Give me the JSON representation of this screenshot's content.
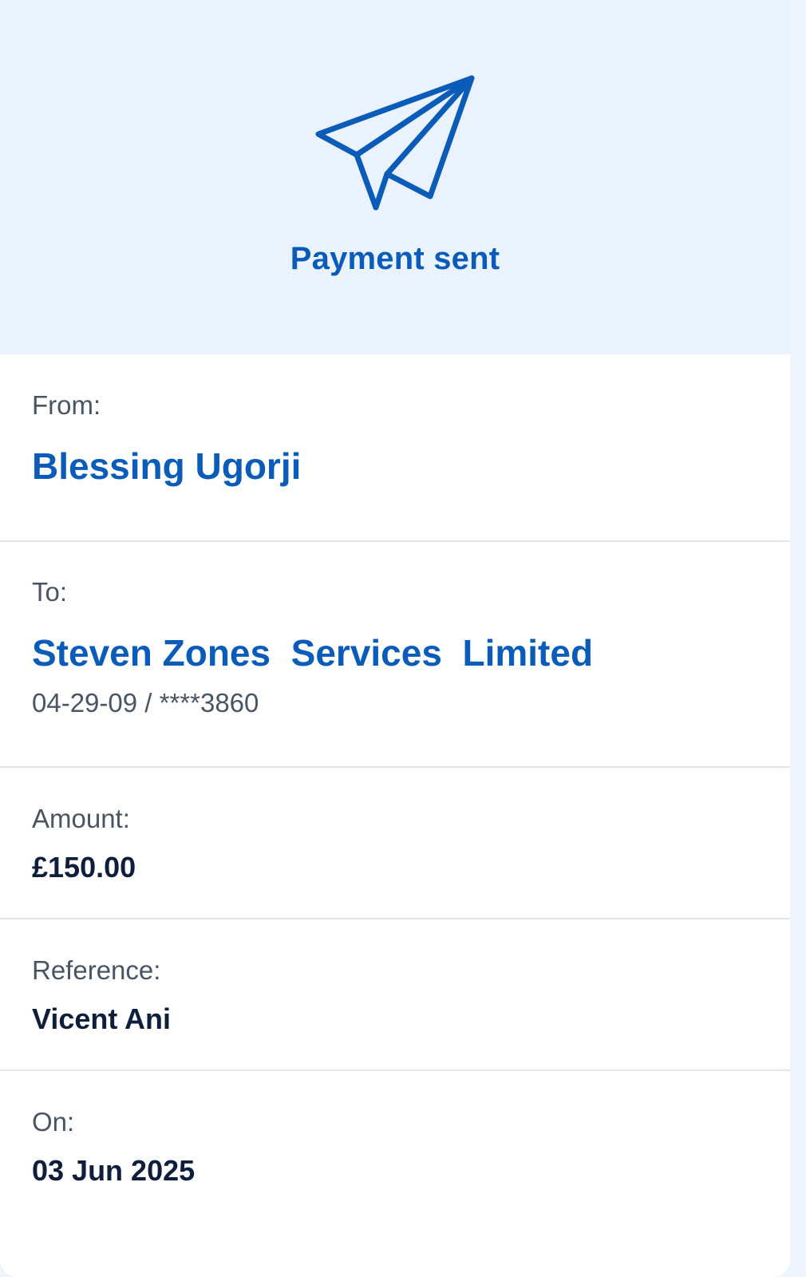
{
  "header": {
    "icon": "paper-plane-icon",
    "title": "Payment sent"
  },
  "from": {
    "label": "From:",
    "name": "Blessing Ugorji"
  },
  "to": {
    "label": "To:",
    "name": "Steven Zones  Services  Limited",
    "account": "04-29-09 / ****3860"
  },
  "amount": {
    "label": "Amount:",
    "value": "£150.00"
  },
  "reference": {
    "label": "Reference:",
    "value": "Vicent Ani"
  },
  "date": {
    "label": "On:",
    "value": "03 Jun 2025"
  },
  "colors": {
    "accent": "#0a5cb8",
    "header_background": "#eaf3fd",
    "text_dark": "#0f1e3a",
    "text_muted": "#4a5563",
    "divider": "#e1e4e8"
  }
}
